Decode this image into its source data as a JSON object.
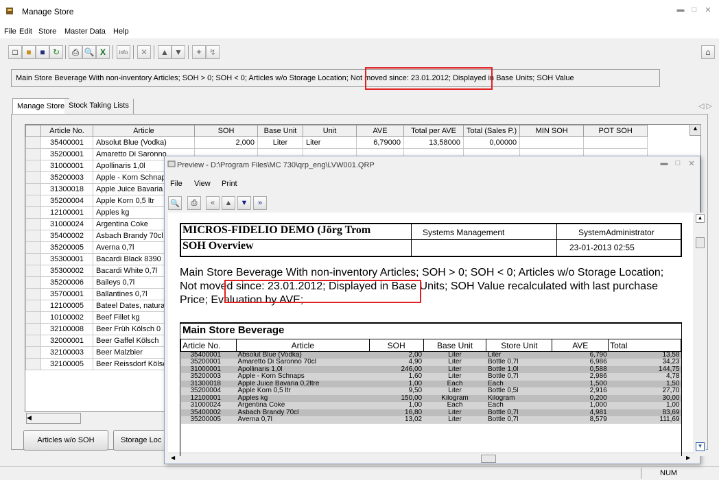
{
  "window": {
    "title": "Manage Store"
  },
  "menu": [
    "File",
    "Edit",
    "Store",
    "Master Data",
    "Help"
  ],
  "filter_text": "Main Store Beverage With non-inventory Articles; SOH > 0; SOH < 0; Articles w/o Storage Location; Not moved since: 23.01.2012; Displayed in Base Units; SOH Value",
  "tabs": [
    "Manage Store",
    "Stock Taking Lists"
  ],
  "grid": {
    "columns": [
      "Article No.",
      "Article",
      "SOH",
      "Base Unit",
      "Unit",
      "AVE",
      "Total per AVE",
      "Total (Sales P.)",
      "MIN SOH",
      "POT SOH"
    ],
    "first_row": [
      "35400001",
      "Absolut Blue (Vodka)",
      "2,000",
      "Liter",
      "Liter",
      "6,79000",
      "13,58000",
      "0,00000",
      "",
      ""
    ],
    "rows": [
      [
        "35200001",
        "Amaretto Di Saronno"
      ],
      [
        "31000001",
        "Apollinaris 1,0l"
      ],
      [
        "35200003",
        "Apple - Korn Schnaps"
      ],
      [
        "31300018",
        "Apple Juice Bavaria"
      ],
      [
        "35200004",
        "Apple Korn 0,5 ltr"
      ],
      [
        "12100001",
        "Apples kg"
      ],
      [
        "31000024",
        "Argentina Coke"
      ],
      [
        "35400002",
        "Asbach Brandy 70cl"
      ],
      [
        "35200005",
        "Averna 0,7l"
      ],
      [
        "35300001",
        "Bacardi Black 8390"
      ],
      [
        "35300002",
        "Bacardi White 0,7l"
      ],
      [
        "35200006",
        "Baileys 0,7l"
      ],
      [
        "35700001",
        "Ballantines 0,7l"
      ],
      [
        "12100005",
        "Bateel Dates, natural"
      ],
      [
        "10100002",
        "Beef Fillet kg"
      ],
      [
        "32100008",
        "Beer Früh Kölsch 0"
      ],
      [
        "32000001",
        "Beer Gaffel Kölsch"
      ],
      [
        "32100003",
        "Beer Malzbier"
      ],
      [
        "32100005",
        "Beer Reissdorf Kölsch"
      ]
    ]
  },
  "buttons": {
    "articles_wo_soh": "Articles w/o SOH",
    "storage_loc": "Storage Loc"
  },
  "status": {
    "num": "NUM"
  },
  "preview": {
    "title": "Preview - D:\\Program Files\\MC 730\\qrp_eng\\LVW001.QRP",
    "menu": [
      "File",
      "View",
      "Print"
    ],
    "report": {
      "company": "MICROS-FIDELIO DEMO (Jörg Trom",
      "department": "Systems Management",
      "user": "SystemAdministrator",
      "subtitle": "SOH Overview",
      "datetime": "23-01-2013 02:55",
      "filter": "Main Store Beverage With non-inventory Articles; SOH > 0; SOH < 0; Articles w/o Storage Location; Not moved since: 23.01.2012; Displayed in Base Units; SOH Value recalculated with last purchase Price; Evaluation by AVE;",
      "section": "Main Store Beverage",
      "columns": [
        "Article No.",
        "Article",
        "SOH",
        "Base Unit",
        "Store Unit",
        "AVE",
        "Total"
      ],
      "rows": [
        [
          "35400001",
          "Absolut Blue (Vodka)",
          "2,00",
          "Liter",
          "Liter",
          "6,790",
          "13,58"
        ],
        [
          "35200001",
          "Amaretto Di Saronno 70cl",
          "4,90",
          "Liter",
          "Bottle 0,7l",
          "6,986",
          "34,23"
        ],
        [
          "31000001",
          "Apollinaris 1,0l",
          "246,00",
          "Liter",
          "Bottle 1,0l",
          "0,588",
          "144,75"
        ],
        [
          "35200003",
          "Apple - Korn Schnaps",
          "1,60",
          "Liter",
          "Bottle 0,7l",
          "2,986",
          "4,78"
        ],
        [
          "31300018",
          "Apple Juice Bavaria 0,2ltre",
          "1,00",
          "Each",
          "Each",
          "1,500",
          "1,50"
        ],
        [
          "35200004",
          "Apple Korn 0,5 ltr",
          "9,50",
          "Liter",
          "Bottle 0,5l",
          "2,916",
          "27,70"
        ],
        [
          "12100001",
          "Apples kg",
          "150,00",
          "Kilogram",
          "Kilogram",
          "0,200",
          "30,00"
        ],
        [
          "31000024",
          "Argentina Coke",
          "1,00",
          "Each",
          "Each",
          "1,000",
          "1,00"
        ],
        [
          "35400002",
          "Asbach Brandy 70cl",
          "16,80",
          "Liter",
          "Bottle 0,7l",
          "4,981",
          "83,69"
        ],
        [
          "35200005",
          "Averna 0,7l",
          "13,02",
          "Liter",
          "Bottle 0,7l",
          "8,579",
          "111,69"
        ]
      ]
    }
  }
}
